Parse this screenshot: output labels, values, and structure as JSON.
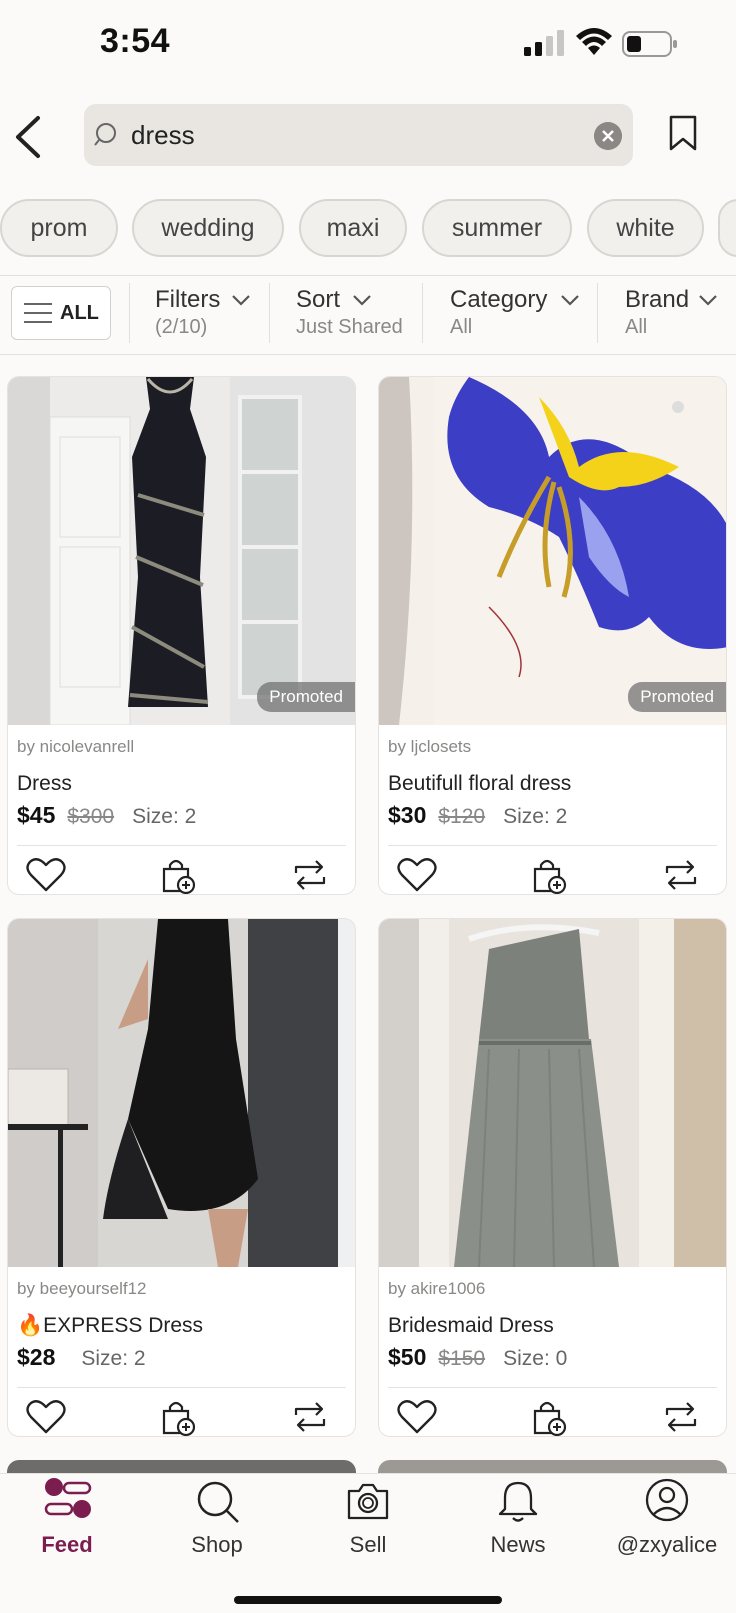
{
  "status_bar": {
    "time": "3:54"
  },
  "search": {
    "query": "dress"
  },
  "chips": [
    "prom",
    "wedding",
    "maxi",
    "summer",
    "white"
  ],
  "filter_bar": {
    "all_label": "ALL",
    "filters": {
      "title": "Filters",
      "sub": "(2/10)"
    },
    "sort": {
      "title": "Sort",
      "sub": "Just Shared"
    },
    "category": {
      "title": "Category",
      "sub": "All"
    },
    "brand": {
      "title": "Brand",
      "sub": "All"
    }
  },
  "listings": [
    {
      "seller": "by nicolevanrell",
      "title": "Dress",
      "price": "$45",
      "original_price": "$300",
      "size": "Size: 2",
      "badge": "Promoted"
    },
    {
      "seller": "by ljclosets",
      "title": "Beutifull floral dress",
      "price": "$30",
      "original_price": "$120",
      "size": "Size: 2",
      "badge": "Promoted"
    },
    {
      "seller": "by beeyourself12",
      "title": "🔥EXPRESS Dress",
      "price": "$28",
      "original_price": "",
      "size": "Size: 2"
    },
    {
      "seller": "by akire1006",
      "title": "Bridesmaid Dress",
      "price": "$50",
      "original_price": "$150",
      "size": "Size: 0"
    }
  ],
  "tab_bar": {
    "feed": "Feed",
    "shop": "Shop",
    "sell": "Sell",
    "news": "News",
    "profile": "@zxyalice"
  },
  "colors": {
    "accent": "#7b1e4f",
    "background": "#fbfaf9"
  }
}
